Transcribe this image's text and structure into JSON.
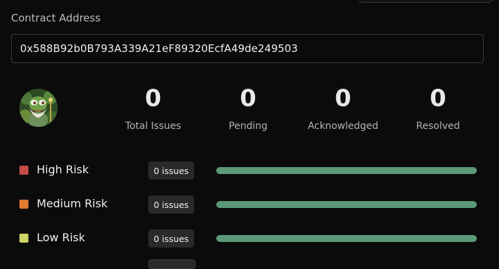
{
  "contract": {
    "label": "Contract Address",
    "address": "0x588B92b0B793A339A21eF89320EcfA49de249503"
  },
  "stats": [
    {
      "value": "0",
      "label": "Total Issues"
    },
    {
      "value": "0",
      "label": "Pending"
    },
    {
      "value": "0",
      "label": "Acknowledged"
    },
    {
      "value": "0",
      "label": "Resolved"
    }
  ],
  "risks": [
    {
      "label": "High Risk",
      "badge": "0 issues",
      "color": "#c44b48",
      "bar_fill_fraction": 1.0,
      "bar_color": "#5b9a78"
    },
    {
      "label": "Medium Risk",
      "badge": "0 issues",
      "color": "#e07a33",
      "bar_fill_fraction": 1.0,
      "bar_color": "#5b9a78"
    },
    {
      "label": "Low Risk",
      "badge": "0 issues",
      "color": "#cfd36a",
      "bar_fill_fraction": 1.0,
      "bar_color": "#5b9a78"
    }
  ]
}
